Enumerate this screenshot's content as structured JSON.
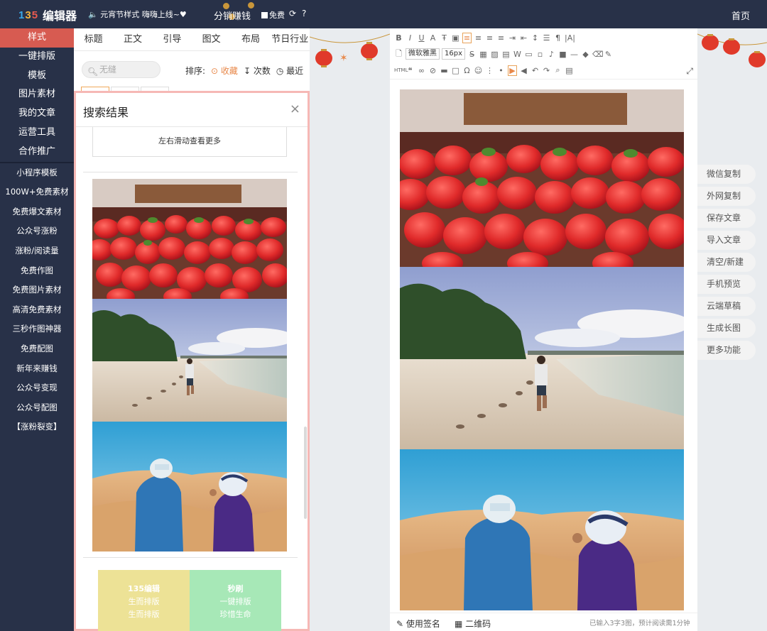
{
  "topbar": {
    "logo_mark": "135",
    "logo_name": "编辑器",
    "notice": "元宵节样式 嗨嗨上线~♥",
    "fenxiao": "分销赚钱",
    "free": "免费",
    "home": "首页"
  },
  "sidebar": {
    "main_items": [
      "样式",
      "一键排版",
      "模板",
      "图片素材",
      "我的文章",
      "运营工具",
      "合作推广"
    ],
    "extra_items": [
      "小程序模板",
      "100W+免费素材",
      "免费爆文素材",
      "公众号涨粉",
      "涨粉/阅读量",
      "免费作图",
      "免费图片素材",
      "高清免费素材",
      "三秒作图神器",
      "免费配图",
      "新年来赚钱",
      "公众号变现",
      "公众号配图",
      "【涨粉裂变】"
    ]
  },
  "left_panel": {
    "tabs": [
      "标题",
      "正文",
      "引导",
      "图文",
      "布局",
      "节日行业"
    ],
    "search_placeholder": "无缝",
    "sort_label": "排序:",
    "sort_options": [
      "收藏",
      "次数",
      "最近"
    ]
  },
  "modal": {
    "title": "搜索结果",
    "close": "×",
    "more_hint": "左右滑动查看更多",
    "promo_left": [
      "135编辑",
      "生而排版",
      "生而排版"
    ],
    "promo_right": [
      "秒刷",
      "一键排版",
      "珍惜生命"
    ]
  },
  "editor": {
    "font_family": "微软雅黑",
    "font_size": "16px",
    "footer_sign": "使用签名",
    "footer_qr": "二维码",
    "word_count": "已输入3字3图，预计阅读需1分钟"
  },
  "right_actions": [
    "微信复制",
    "外网复制",
    "保存文章",
    "导入文章",
    "清空/新建",
    "手机预览",
    "云端草稿",
    "生成长图",
    "更多功能"
  ]
}
